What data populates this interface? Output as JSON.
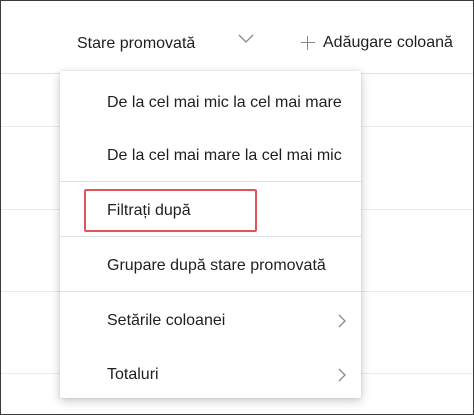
{
  "header": {
    "column_label": "Stare promovată",
    "column_dropdown_icon": "chevron-down-icon",
    "add_column_icon": "plus-icon",
    "add_column_label": "Adăugare coloană"
  },
  "menu": {
    "items": [
      {
        "label": "De la cel mai mic la cel mai mare",
        "has_submenu": false
      },
      {
        "label": "De la cel mai mare la cel mai mic",
        "has_submenu": false
      },
      {
        "label": "Filtrați după",
        "has_submenu": false,
        "highlighted": true
      },
      {
        "label": "Grupare după stare promovată",
        "has_submenu": false
      },
      {
        "label": "Setările coloanei",
        "has_submenu": true,
        "icon": "chevron-right-icon"
      },
      {
        "label": "Totaluri",
        "has_submenu": true,
        "icon": "chevron-right-icon"
      }
    ]
  },
  "colors": {
    "text": "#201f1e",
    "divider": "#e1e1e1",
    "highlight_border": "#e2545b",
    "icon": "#8a8886"
  }
}
